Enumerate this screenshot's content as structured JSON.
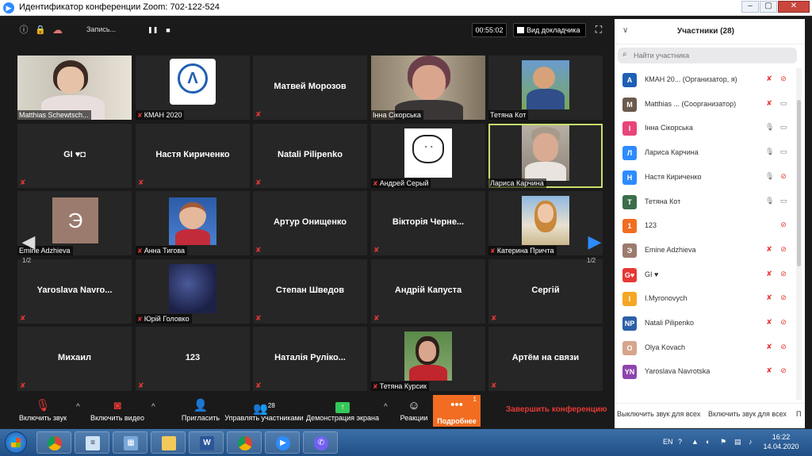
{
  "window": {
    "title": "Идентификатор конференции Zoom: 702-122-524",
    "zoom_icon": "zoom-camera-icon",
    "controls": [
      "–",
      "▢",
      "✕"
    ]
  },
  "meeting_top": {
    "info_icon": "ⓘ",
    "lock_icon": "🔒",
    "cloud_icon": "☁",
    "recording_label": "Запись...",
    "pause_icon": "❚❚",
    "stop_icon": "■",
    "timer": "00:55:02",
    "view_button": "Вид докладчика",
    "fullscreen_icon": "⛶"
  },
  "colors": {
    "active_speaker_border": "#c8df6c",
    "muted_red": "#e53935",
    "more_orange": "#f26d21",
    "zoom_blue": "#2d8cff"
  },
  "tiles": [
    {
      "label": "Matthias Schewtsch...",
      "kind": "photo"
    },
    {
      "label": "КМАН 2020",
      "kind": "logo"
    },
    {
      "label": "",
      "name": "Матвей Морозов",
      "kind": "name"
    },
    {
      "label": "Інна Сікорська",
      "kind": "photo"
    },
    {
      "label": "Тетяна Кот",
      "kind": "photo"
    },
    {
      "label": "",
      "name": "GI ♥◘",
      "kind": "name"
    },
    {
      "label": "",
      "name": "Настя Кириченко",
      "kind": "name"
    },
    {
      "label": "",
      "name": "Natali Pilipenko",
      "kind": "name"
    },
    {
      "label": "Андрей Серый",
      "kind": "photo"
    },
    {
      "label": "Лариса Карчина",
      "kind": "photo",
      "active": true
    },
    {
      "label": "Emine Adzhieva",
      "kind": "letter",
      "letter": "Э"
    },
    {
      "label": "Анна Тигова",
      "kind": "photo"
    },
    {
      "label": "",
      "name": "Артур Онищенко",
      "kind": "name"
    },
    {
      "label": "",
      "name": "Вікторія Черне...",
      "kind": "name"
    },
    {
      "label": "Катерина Причта",
      "kind": "photo"
    },
    {
      "label": "",
      "name": "Yaroslava Navro...",
      "kind": "name"
    },
    {
      "label": "Юрій Головко",
      "kind": "photo"
    },
    {
      "label": "",
      "name": "Степан Шведов",
      "kind": "name"
    },
    {
      "label": "",
      "name": "Андрій Капуста",
      "kind": "name"
    },
    {
      "label": "",
      "name": "Сергій",
      "kind": "name"
    },
    {
      "label": "",
      "name": "Михаил",
      "kind": "name"
    },
    {
      "label": "",
      "name": "123",
      "kind": "name"
    },
    {
      "label": "",
      "name": "Наталія Руліко...",
      "kind": "name"
    },
    {
      "label": "Тетяна Курсик",
      "kind": "photo"
    },
    {
      "label": "",
      "name": "Артём на связи",
      "kind": "name"
    }
  ],
  "pager": {
    "left_arrow": "◀",
    "right_arrow": "▶",
    "left_page": "1/2",
    "right_page": "1/2"
  },
  "toolbar": {
    "unmute": {
      "icon": "mic-muted-icon",
      "label": "Включить звук"
    },
    "start_video": {
      "icon": "camera-off-icon",
      "label": "Включить видео"
    },
    "invite": {
      "icon": "add-user-icon",
      "label": "Пригласить"
    },
    "manage": {
      "icon": "participants-icon",
      "label": "Управлять участниками",
      "count": "28"
    },
    "share": {
      "icon": "share-screen-icon",
      "label": "Демонстрация экрана"
    },
    "reactions": {
      "icon": "smiley-icon",
      "label": "Реакции"
    },
    "more": {
      "icon": "ellipsis-icon",
      "label": "Подробнее",
      "badge": "1"
    },
    "caret": "^",
    "end": "Завершить конференцию"
  },
  "panel": {
    "title": "Участники (28)",
    "collapse_icon": "∨",
    "search_icon": "⌕",
    "search_placeholder": "Найти участника",
    "participants": [
      {
        "name": "КМАН 20... (Организатор, я)",
        "avatar": "A",
        "color": "#1f5fb4",
        "mic": "off",
        "cam": "off"
      },
      {
        "name": "Matthias ... (Соорганизатор)",
        "avatar": "M",
        "color": "#6b5a4e",
        "mic": "off",
        "cam": "on"
      },
      {
        "name": "Інна Сікорська",
        "avatar": "І",
        "color": "#e8457a",
        "mic": "on",
        "cam": "on"
      },
      {
        "name": "Лариса Карчина",
        "avatar": "Л",
        "color": "#2d8cff",
        "mic": "on",
        "cam": "on"
      },
      {
        "name": "Настя Кириченко",
        "avatar": "Н",
        "color": "#2d8cff",
        "mic": "on",
        "cam": "off"
      },
      {
        "name": "Тетяна Кот",
        "avatar": "Т",
        "color": "#3b6e4a",
        "mic": "on",
        "cam": "on"
      },
      {
        "name": "123",
        "avatar": "1",
        "color": "#f26d21",
        "mic": "",
        "cam": "off"
      },
      {
        "name": "Emine Adzhieva",
        "avatar": "Э",
        "color": "#9b7b6e",
        "mic": "off",
        "cam": "off"
      },
      {
        "name": "GI ♥",
        "avatar": "G♥",
        "color": "#e53935",
        "mic": "off",
        "cam": "off"
      },
      {
        "name": "I.Myronovych",
        "avatar": "I",
        "color": "#f5a623",
        "mic": "off",
        "cam": "off"
      },
      {
        "name": "Natali Pilipenko",
        "avatar": "NP",
        "color": "#2d5fa8",
        "mic": "off",
        "cam": "off"
      },
      {
        "name": "Olya Kovach",
        "avatar": "O",
        "color": "#d7a48c",
        "mic": "off",
        "cam": "off"
      },
      {
        "name": "Yaroslava Navrotska",
        "avatar": "YN",
        "color": "#8e44ad",
        "mic": "off",
        "cam": "off"
      }
    ],
    "footer": {
      "mute_all": "Выключить звук для всех",
      "unmute_all": "Включить звук для всех",
      "more": "П"
    }
  },
  "taskbar": {
    "apps": [
      "chrome",
      "notepad",
      "control-panel",
      "explorer",
      "word",
      "chrome",
      "zoom",
      "viber"
    ],
    "language": "EN",
    "time": "16:22",
    "date": "14.04.2020"
  }
}
